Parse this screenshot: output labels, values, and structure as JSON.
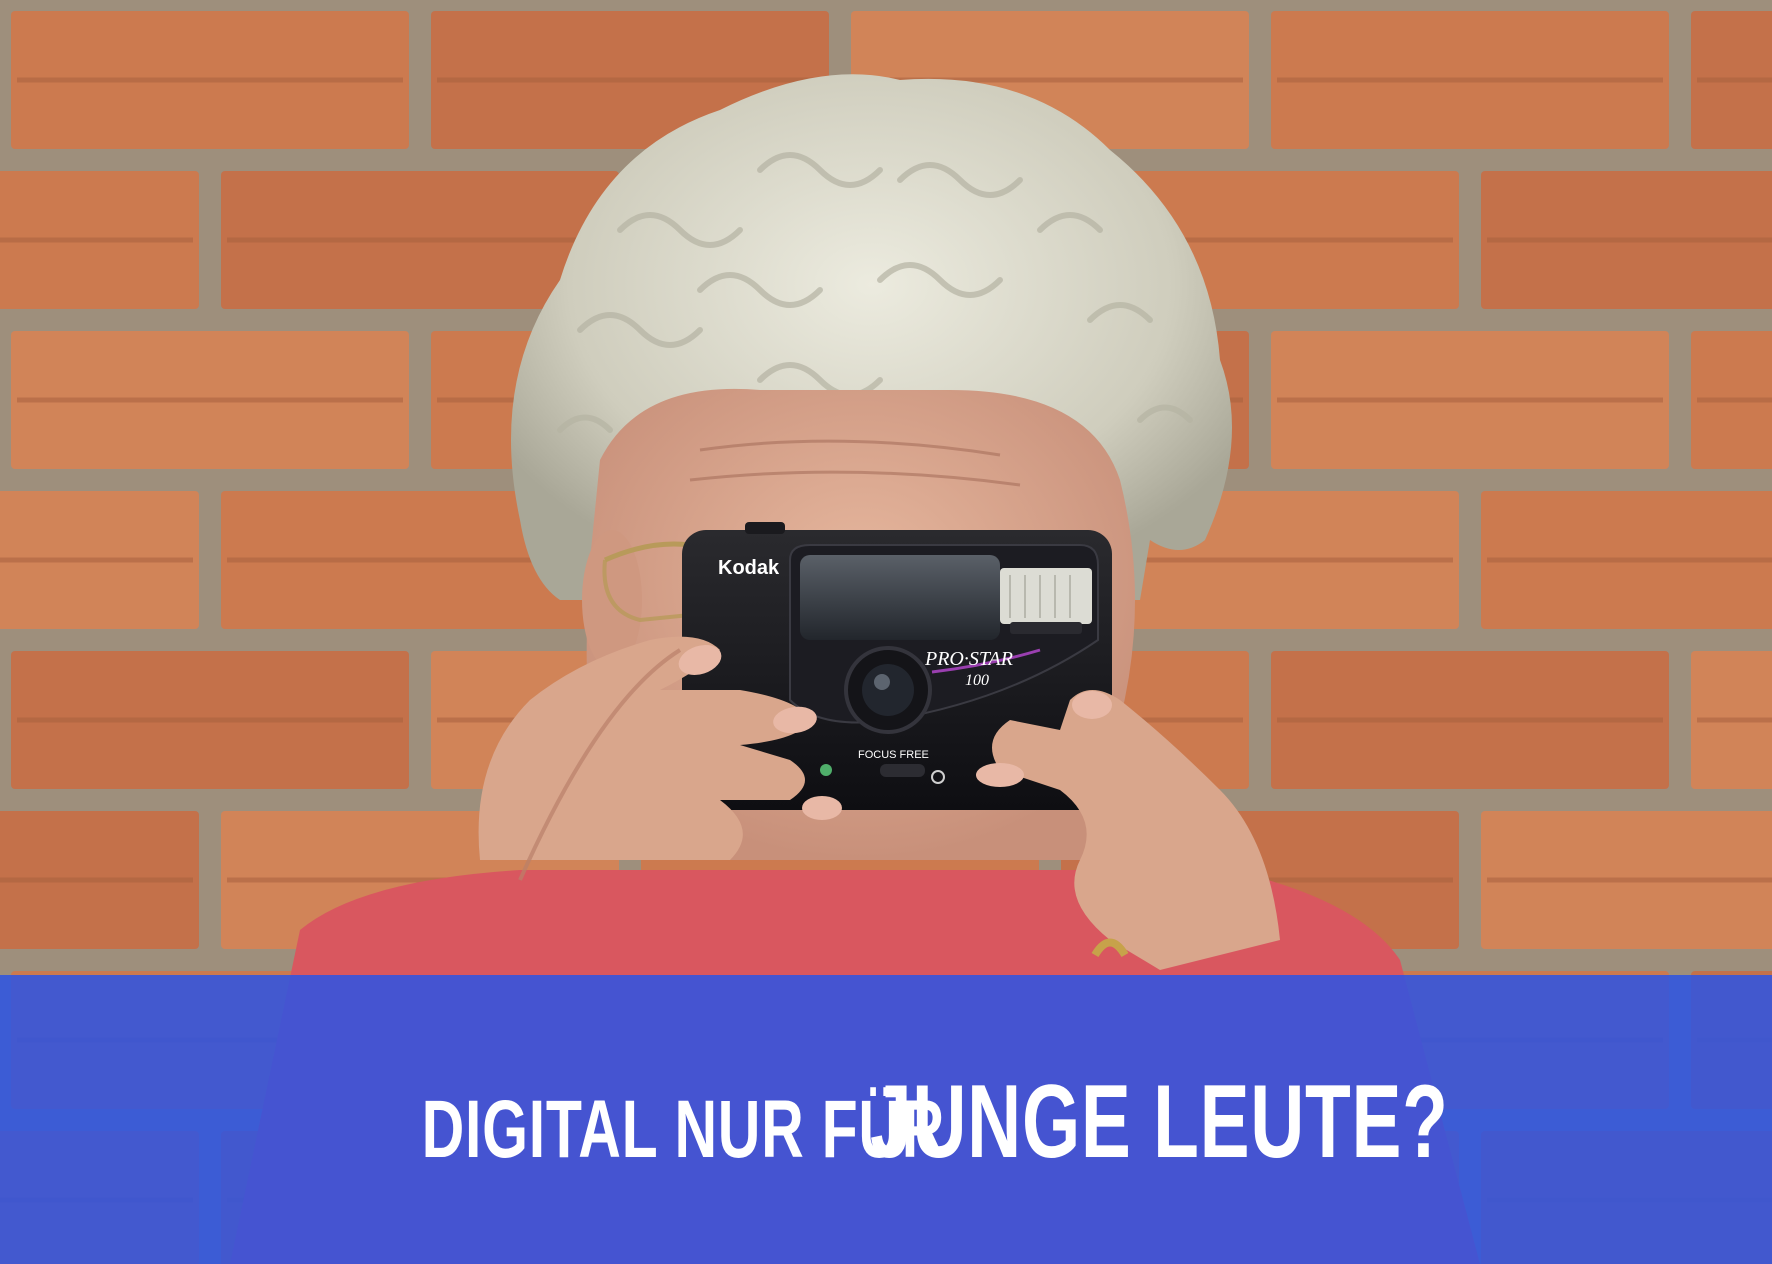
{
  "headline": {
    "part_small": "DIGITAL NUR FÜR",
    "part_large": "JUNGE LEUTE?"
  },
  "camera": {
    "brand": "Kodak",
    "model": "PRO·STAR",
    "model_number": "100",
    "focus_label": "FOCUS FREE"
  },
  "colors": {
    "banner": "#2c54e4",
    "brick": "#c9774d",
    "mortar": "#9e8f7c",
    "hair": "#d9d8c8",
    "shirt": "#d9575f"
  }
}
